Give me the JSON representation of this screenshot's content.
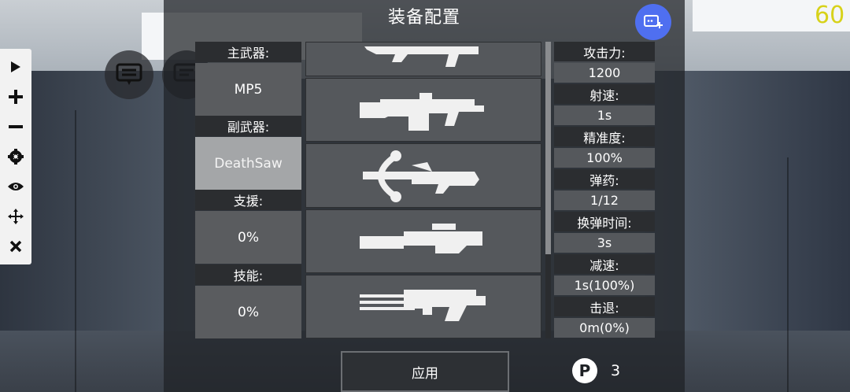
{
  "hud": {
    "fps": "60",
    "title": "装备配置"
  },
  "slots": [
    {
      "label": "主武器:",
      "value": "MP5"
    },
    {
      "label": "副武器:",
      "value": "DeathSaw"
    },
    {
      "label": "支援:",
      "value": "0%"
    },
    {
      "label": "技能:",
      "value": "0%"
    }
  ],
  "weapons": [
    {
      "icon": "rifle-icon"
    },
    {
      "icon": "heavy-machine-gun-icon"
    },
    {
      "icon": "crossbow-icon"
    },
    {
      "icon": "sniper-rifle-icon"
    },
    {
      "icon": "minigun-icon"
    }
  ],
  "stats": [
    {
      "key": "攻击力:",
      "value": "1200"
    },
    {
      "key": "射速:",
      "value": "1s"
    },
    {
      "key": "精准度:",
      "value": "100%"
    },
    {
      "key": "弹药:",
      "value": "1/12"
    },
    {
      "key": "换弹时间:",
      "value": "3s"
    },
    {
      "key": "减速:",
      "value": "1s(100%)"
    },
    {
      "key": "击退:",
      "value": "0m(0%)"
    }
  ],
  "footer": {
    "apply_label": "应用",
    "points_icon_label": "P",
    "points": "3"
  },
  "colors": {
    "accent": "#4f6ff0",
    "fps": "#d7d21a"
  }
}
